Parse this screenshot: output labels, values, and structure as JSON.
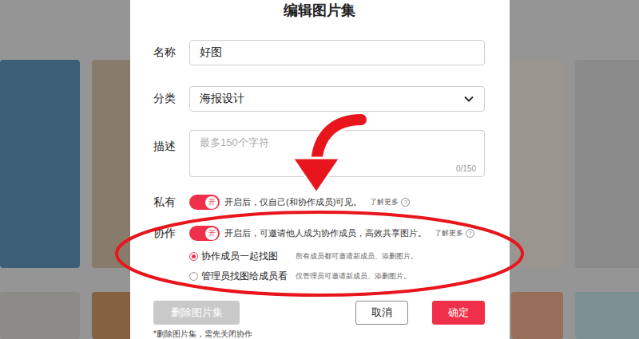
{
  "dialog": {
    "title": "编辑图片集"
  },
  "fields": [
    {
      "label": "名称",
      "kind": "input",
      "value": "好图"
    },
    {
      "label": "分类",
      "kind": "select",
      "value": "海报设计"
    },
    {
      "label": "描述",
      "kind": "textarea",
      "placeholder": "最多150个字符",
      "counter": "0/150"
    }
  ],
  "toggles": [
    {
      "label": "私有",
      "on": true,
      "switch_text": "开",
      "description": "开启后，仅自己(和协作成员)可见。",
      "link": "了解更多",
      "help": "?"
    },
    {
      "label": "协作",
      "on": true,
      "switch_text": "开",
      "description": "开启后，可邀请他人成为协作成员，高效共享图片。",
      "link": "了解更多",
      "help": "?"
    }
  ],
  "radios": [
    {
      "label": "协作成员一起找图",
      "hint": "所有成员都可邀请新成员、添删图片。",
      "selected": true
    },
    {
      "label": "管理员找图给成员看",
      "hint": "仅管理员可邀请新成员、添删图片。",
      "selected": false
    }
  ],
  "buttons": [
    {
      "label": "删除图片集",
      "kind": "danger",
      "disabled": true
    },
    {
      "label": "取消",
      "kind": "secondary",
      "disabled": false
    },
    {
      "label": "确定",
      "kind": "primary",
      "disabled": false
    }
  ],
  "note": "*删除图片集，需先关闭协作"
}
